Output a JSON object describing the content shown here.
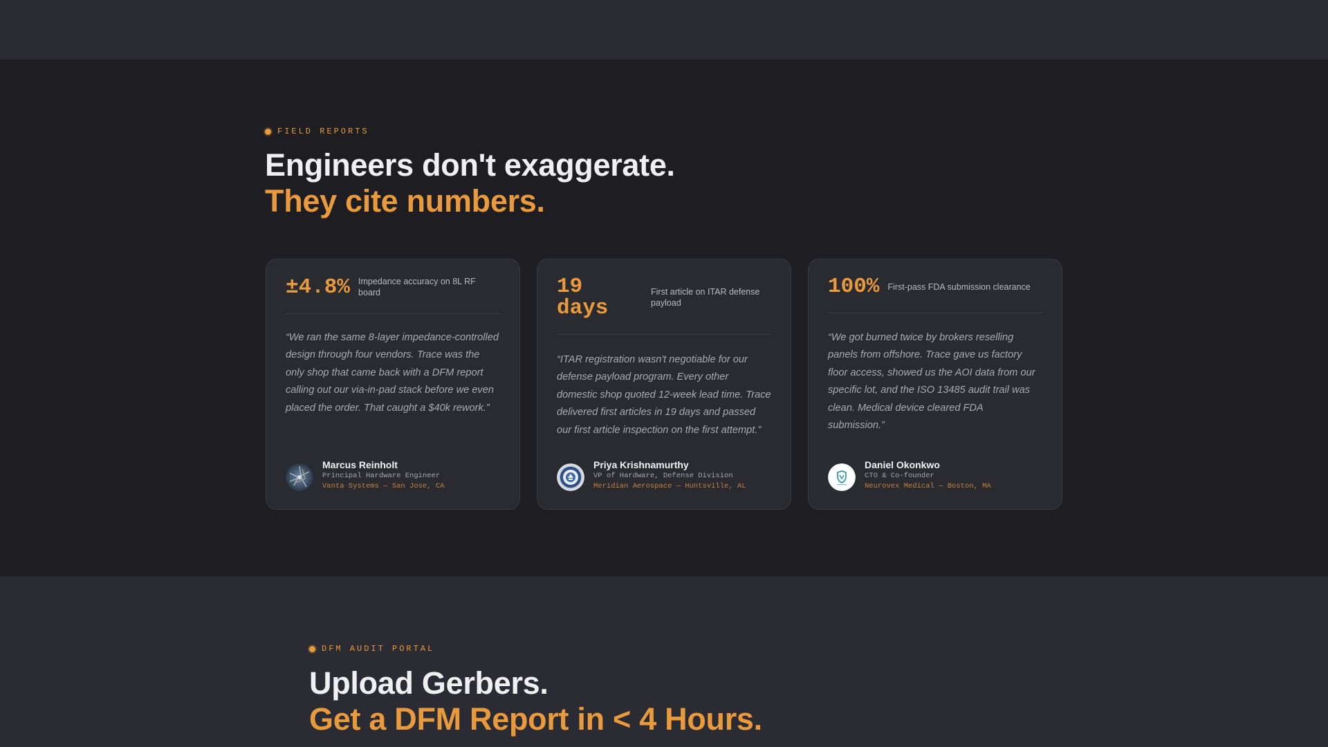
{
  "colors": {
    "accent": "#e89a3c",
    "background": "#1d1d22",
    "band": "#2b2b33",
    "card": "#2a2a31"
  },
  "field_reports": {
    "eyebrow": "FIELD REPORTS",
    "headline_line1": "Engineers don't exaggerate.",
    "headline_line2": "They cite numbers.",
    "cards": [
      {
        "stat": "±4.8%",
        "stat_desc": "Impedance accuracy on 8L RF board",
        "quote": "“We ran the same 8-layer impedance-controlled design through four vendors. Trace was the only shop that came back with a DFM report calling out our via-in-pad stack before we even placed the order. That caught a $40k rework.”",
        "name": "Marcus Reinholt",
        "role": "Principal Hardware Engineer",
        "company": "Vanta Systems — San Jose, CA",
        "avatar_icon": "circuit-photo-avatar"
      },
      {
        "stat": "19 days",
        "stat_desc": "First article on ITAR defense payload",
        "quote": "“ITAR registration wasn't negotiable for our defense payload program. Every other domestic shop quoted 12-week lead time. Trace delivered first articles in 19 days and passed our first article inspection on the first attempt.”",
        "name": "Priya Krishnamurthy",
        "role": "VP of Hardware, Defense Division",
        "company": "Meridian Aerospace — Huntsville, AL",
        "avatar_icon": "seal-emblem-avatar"
      },
      {
        "stat": "100%",
        "stat_desc": "First-pass FDA submission clearance",
        "quote": "“We got burned twice by brokers reselling panels from offshore. Trace gave us factory floor access, showed us the AOI data from our specific lot, and the ISO 13485 audit trail was clean. Medical device cleared FDA submission.”",
        "name": "Daniel Okonkwo",
        "role": "CTO & Co-founder",
        "company": "Neurovex Medical — Boston, MA",
        "avatar_icon": "shield-logo-avatar"
      }
    ]
  },
  "dfm_portal": {
    "eyebrow": "DFM AUDIT PORTAL",
    "headline_line1": "Upload Gerbers.",
    "headline_line2": "Get a DFM Report in < 4 Hours."
  }
}
